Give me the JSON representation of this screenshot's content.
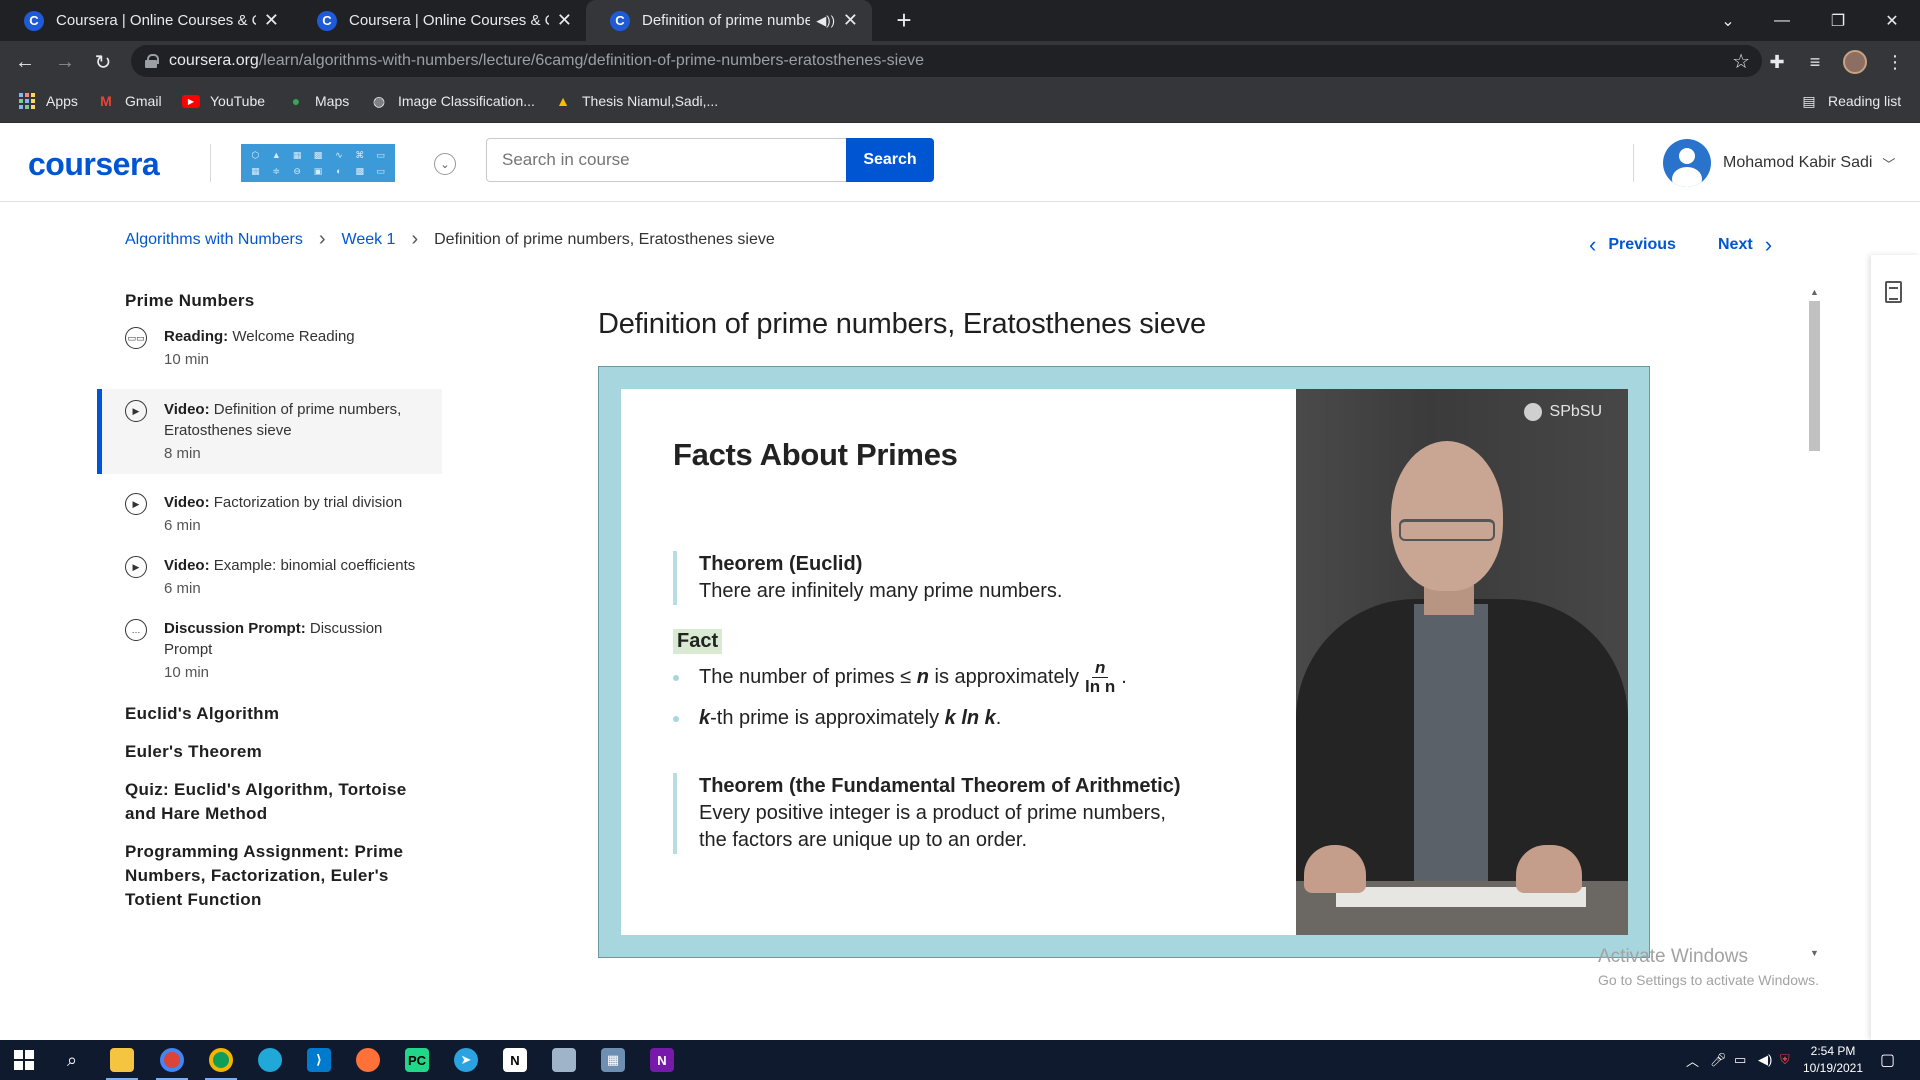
{
  "browser": {
    "tabs": [
      {
        "title": "Coursera | Online Courses & Credentials From Top Educators",
        "active": false
      },
      {
        "title": "Coursera | Online Courses & Credentials From Top Educators",
        "active": false
      },
      {
        "title": "Definition of prime numbers, Eratosthenes sieve",
        "active": true,
        "audio": true
      }
    ],
    "url_host": "coursera.org",
    "url_path": "/learn/algorithms-with-numbers/lecture/6camg/definition-of-prime-numbers-eratosthenes-sieve",
    "bookmarks": [
      "Apps",
      "Gmail",
      "YouTube",
      "Maps",
      "Image Classification...",
      "Thesis Niamul,Sadi,..."
    ],
    "reading_list": "Reading list"
  },
  "header": {
    "logo": "coursera",
    "search_placeholder": "Search in course",
    "search_button": "Search",
    "user_name": "Mohamod Kabir Sadi"
  },
  "breadcrumb": {
    "course": "Algorithms with Numbers",
    "week": "Week 1",
    "current": "Definition of prime numbers, Eratosthenes sieve"
  },
  "nav": {
    "previous": "Previous",
    "next": "Next"
  },
  "sidebar": {
    "module_title": "Prime Numbers",
    "items": [
      {
        "type": "Reading:",
        "name": "Welcome Reading",
        "duration": "10 min",
        "icon": "book-icon"
      },
      {
        "type": "Video:",
        "name": "Definition of prime numbers, Eratosthenes sieve",
        "duration": "8 min",
        "icon": "play-icon",
        "active": true
      },
      {
        "type": "Video:",
        "name": "Factorization by trial division",
        "duration": "6 min",
        "icon": "play-icon"
      },
      {
        "type": "Video:",
        "name": "Example: binomial coefficients",
        "duration": "6 min",
        "icon": "play-icon"
      },
      {
        "type": "Discussion Prompt:",
        "name": "Discussion Prompt",
        "duration": "10 min",
        "icon": "chat-icon"
      }
    ],
    "modules": [
      "Euclid's Algorithm",
      "Euler's Theorem",
      "Quiz: Euclid's Algorithm, Tortoise and Hare Method",
      "Programming Assignment: Prime Numbers, Factorization, Euler's Totient Function"
    ]
  },
  "lecture": {
    "title": "Definition of prime numbers, Eratosthenes sieve",
    "slide": {
      "heading": "Facts About Primes",
      "theorem1_title": "Theorem (Euclid)",
      "theorem1_body": "There are infinitely many prime numbers.",
      "fact_label": "Fact",
      "bullet1_pre": "The number of primes ≤",
      "bullet1_n": "n",
      "bullet1_mid": "is approximately",
      "frac_num": "n",
      "frac_den": "ln n",
      "bullet2_k": "k",
      "bullet2_mid": "-th prime is approximately",
      "bullet2_expr": "k ln k",
      "theorem2_title": "Theorem (the Fundamental Theorem of Arithmetic)",
      "theorem2_body1": "Every positive integer is a product of prime numbers,",
      "theorem2_body2": "the factors are unique up to an order."
    },
    "video_brand": "SPbSU"
  },
  "watermark": {
    "line1": "Activate Windows",
    "line2": "Go to Settings to activate Windows."
  },
  "taskbar": {
    "time": "2:54 PM",
    "date": "10/19/2021"
  }
}
